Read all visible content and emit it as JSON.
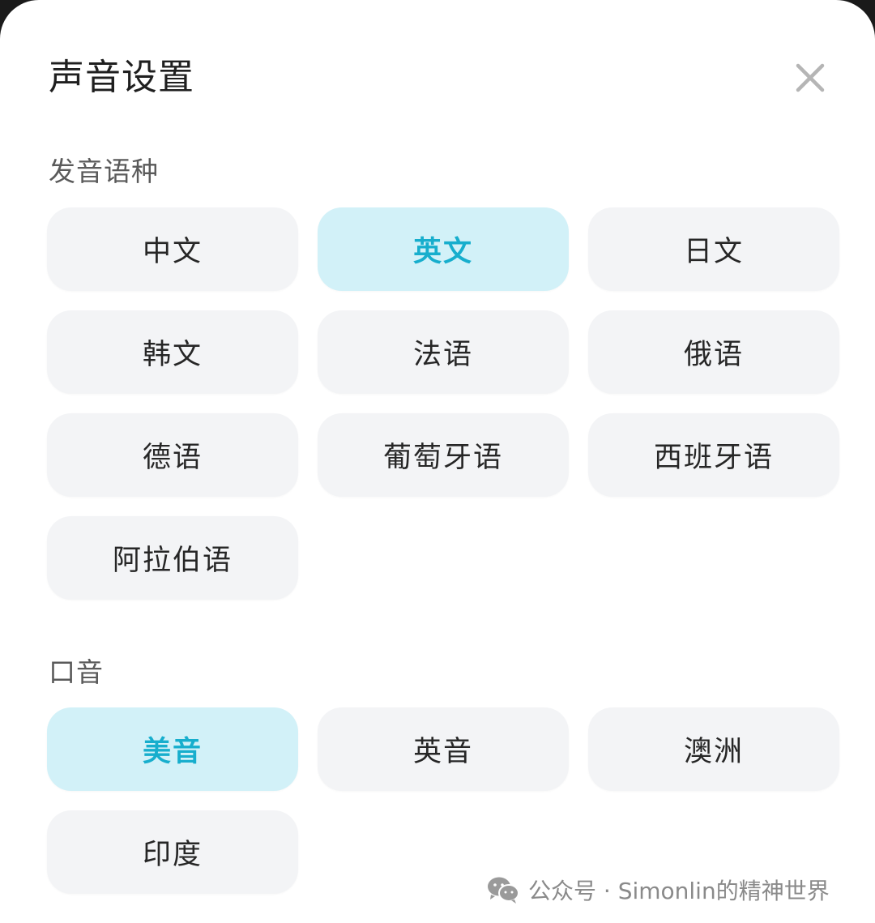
{
  "dialog": {
    "title": "声音设置"
  },
  "language_section": {
    "label": "发音语种",
    "selected": "英文",
    "options": [
      "中文",
      "英文",
      "日文",
      "韩文",
      "法语",
      "俄语",
      "德语",
      "葡萄牙语",
      "西班牙语",
      "阿拉伯语"
    ]
  },
  "accent_section": {
    "label": "口音",
    "selected": "美音",
    "options": [
      "美音",
      "英音",
      "澳洲",
      "印度"
    ]
  },
  "watermark": {
    "text": "公众号 · Simonlin的精神世界",
    "icon": "wechat-icon"
  },
  "colors": {
    "selected_bg": "#d2f1f8",
    "selected_text": "#17aecd",
    "chip_bg": "#f3f4f6"
  }
}
